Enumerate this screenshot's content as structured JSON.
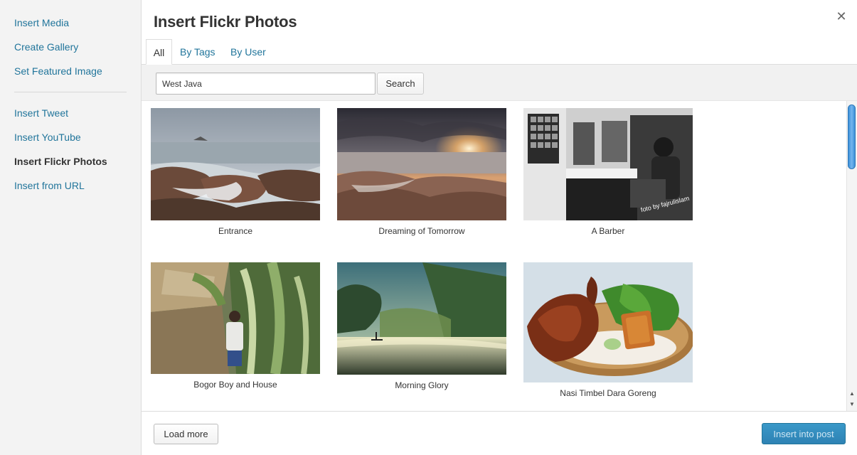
{
  "sidebar": {
    "items": [
      {
        "label": "Insert Media"
      },
      {
        "label": "Create Gallery"
      },
      {
        "label": "Set Featured Image"
      },
      {
        "label": "Insert Tweet"
      },
      {
        "label": "Insert YouTube"
      },
      {
        "label": "Insert Flickr Photos",
        "active": true
      },
      {
        "label": "Insert from URL"
      }
    ]
  },
  "header": {
    "title": "Insert Flickr Photos",
    "close_glyph": "✕"
  },
  "tabs": [
    {
      "label": "All",
      "active": true
    },
    {
      "label": "By Tags"
    },
    {
      "label": "By User"
    }
  ],
  "search": {
    "value": "West Java",
    "button_label": "Search"
  },
  "photos": [
    {
      "caption": "Entrance"
    },
    {
      "caption": "Dreaming of Tomorrow"
    },
    {
      "caption": "A Barber",
      "watermark": "foto by fajrulislam"
    },
    {
      "caption": "Bogor Boy and House"
    },
    {
      "caption": "Morning Glory"
    },
    {
      "caption": "Nasi Timbel Dara Goreng"
    }
  ],
  "footer": {
    "load_more_label": "Load more",
    "insert_label": "Insert into post"
  },
  "colors": {
    "link": "#21759b",
    "primary_button": "#2e82b4"
  }
}
